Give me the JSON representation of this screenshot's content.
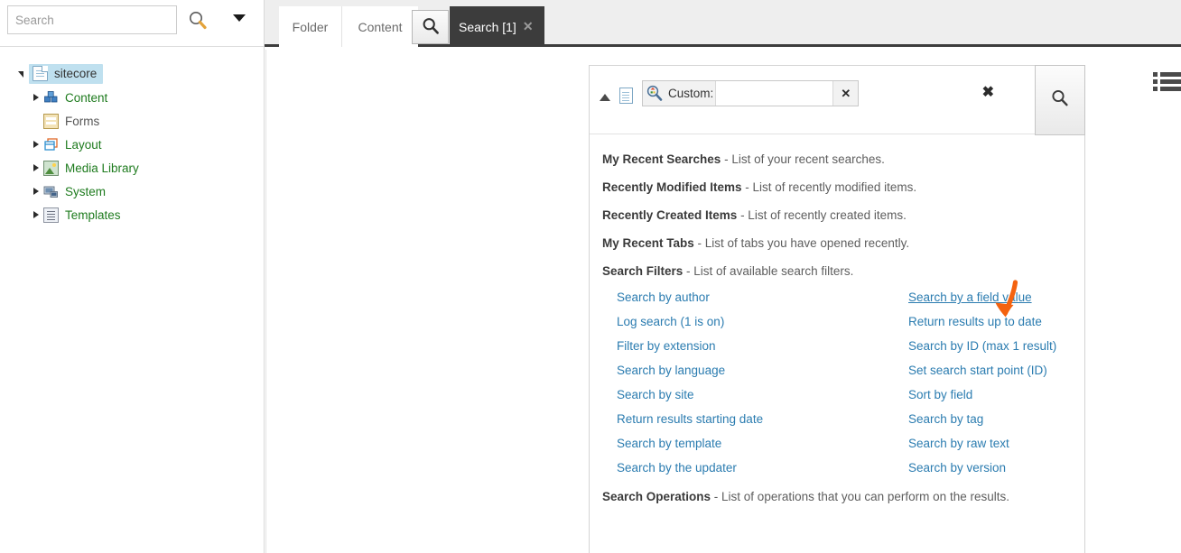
{
  "left_panel": {
    "search": {
      "placeholder": "Search",
      "value": "",
      "magnifier_icon": "search-icon",
      "dropdown_icon": "caret-down-icon"
    },
    "tree": [
      {
        "label": "sitecore",
        "icon": "document-icon",
        "state": "expanded",
        "depth": 0,
        "selected": true
      },
      {
        "label": "Content",
        "icon": "content-cubes-icon",
        "state": "collapsed",
        "depth": 1,
        "selected": false
      },
      {
        "label": "Forms",
        "icon": "forms-icon",
        "state": "leaf",
        "depth": 1,
        "selected": false
      },
      {
        "label": "Layout",
        "icon": "layout-icon",
        "state": "collapsed",
        "depth": 1,
        "selected": false
      },
      {
        "label": "Media Library",
        "icon": "media-image-icon",
        "state": "collapsed",
        "depth": 1,
        "selected": false
      },
      {
        "label": "System",
        "icon": "system-icon",
        "state": "collapsed",
        "depth": 1,
        "selected": false
      },
      {
        "label": "Templates",
        "icon": "templates-icon",
        "state": "collapsed",
        "depth": 1,
        "selected": false
      }
    ]
  },
  "tabs": [
    {
      "label": "Folder",
      "active": false,
      "closable": false
    },
    {
      "label": "Content",
      "active": false,
      "closable": false
    },
    {
      "label": "",
      "active": false,
      "closable": false,
      "icon": "search-icon"
    },
    {
      "label": "Search [1]",
      "active": true,
      "closable": true,
      "close_label": "✕"
    }
  ],
  "search_panel": {
    "collapse_icon": "triangle-up-icon",
    "item_icon": "document-icon",
    "filter_chip": {
      "icon": "search-filter-icon",
      "label": "Custom:",
      "value": "",
      "remove_label": "✕"
    },
    "clear_all_label": "✖",
    "run_search_icon": "search-icon",
    "sections": [
      {
        "title": "My Recent Searches",
        "desc": " - List of your recent searches."
      },
      {
        "title": "Recently Modified Items",
        "desc": " - List of recently modified items."
      },
      {
        "title": "Recently Created Items",
        "desc": " - List of recently created items."
      },
      {
        "title": "My Recent Tabs",
        "desc": " - List of tabs you have opened recently."
      },
      {
        "title": "Search Filters",
        "desc": " - List of available search filters."
      }
    ],
    "filters_left": [
      "Search by author",
      "Log search (1 is on)",
      "Filter by extension",
      "Search by language",
      "Search by site",
      "Return results starting date",
      "Search by template",
      "Search by the updater"
    ],
    "filters_right": [
      "Search by a field value",
      "Return results up to date",
      "Search by ID (max 1 result)",
      "Set search start point (ID)",
      "Sort by field",
      "Search by tag",
      "Search by raw text",
      "Search by version"
    ],
    "highlighted_filter": "Search by a field value",
    "operations_section": {
      "title": "Search Operations",
      "desc": " - List of operations that you can perform on the results."
    }
  },
  "list_view_icon": "list-view-icon",
  "annotation": {
    "type": "arrow",
    "color": "#f4620f",
    "points_to": "Search by a field value"
  },
  "colors": {
    "active_tab_bg": "#3c3c3c",
    "link": "#2b7cb0",
    "tree_label": "#1e7b1e",
    "selection": "#bfe0ef",
    "annotation": "#f4620f"
  }
}
